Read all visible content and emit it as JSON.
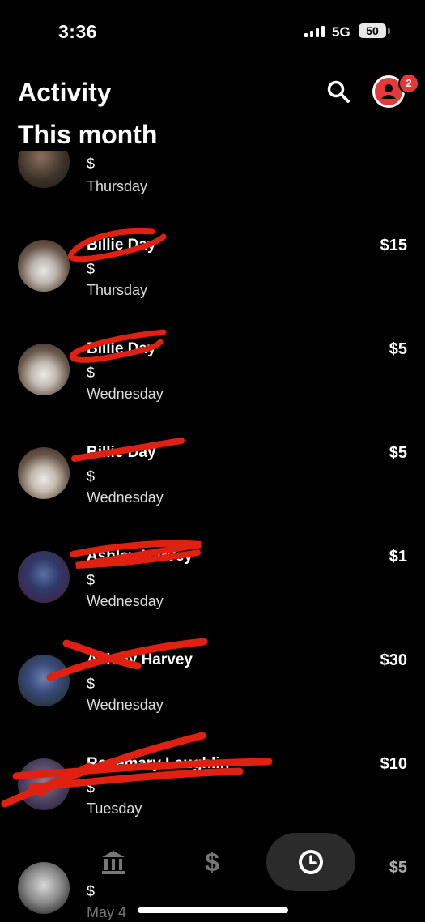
{
  "status_bar": {
    "time": "3:36",
    "network": "5G",
    "battery": "50"
  },
  "header": {
    "title": "Activity",
    "notification_count": "2"
  },
  "section": {
    "title": "This month"
  },
  "colors": {
    "accent": "#e5383b",
    "background": "#000000",
    "scribble": "#e02010"
  },
  "transactions": [
    {
      "name": "",
      "type": "$",
      "day": "Thursday",
      "amount": ""
    },
    {
      "name": "Billie Day",
      "type": "$",
      "day": "Thursday",
      "amount": "$15"
    },
    {
      "name": "Billie Day",
      "type": "$",
      "day": "Wednesday",
      "amount": "$5"
    },
    {
      "name": "Billie Day",
      "type": "$",
      "day": "Wednesday",
      "amount": "$5"
    },
    {
      "name": "Ashley Harvey",
      "type": "$",
      "day": "Wednesday",
      "amount": "$1"
    },
    {
      "name": "Ashley Harvey",
      "type": "$",
      "day": "Wednesday",
      "amount": "$30"
    },
    {
      "name": "Rosemary Laughlin",
      "type": "$",
      "day": "Tuesday",
      "amount": "$10"
    },
    {
      "name": "",
      "type": "$",
      "day": "May 4",
      "amount": "$5"
    }
  ],
  "tabbar": {
    "items": [
      {
        "icon": "bank-icon",
        "active": false
      },
      {
        "icon": "dollar-icon",
        "active": false
      },
      {
        "icon": "clock-icon",
        "active": true
      }
    ]
  }
}
